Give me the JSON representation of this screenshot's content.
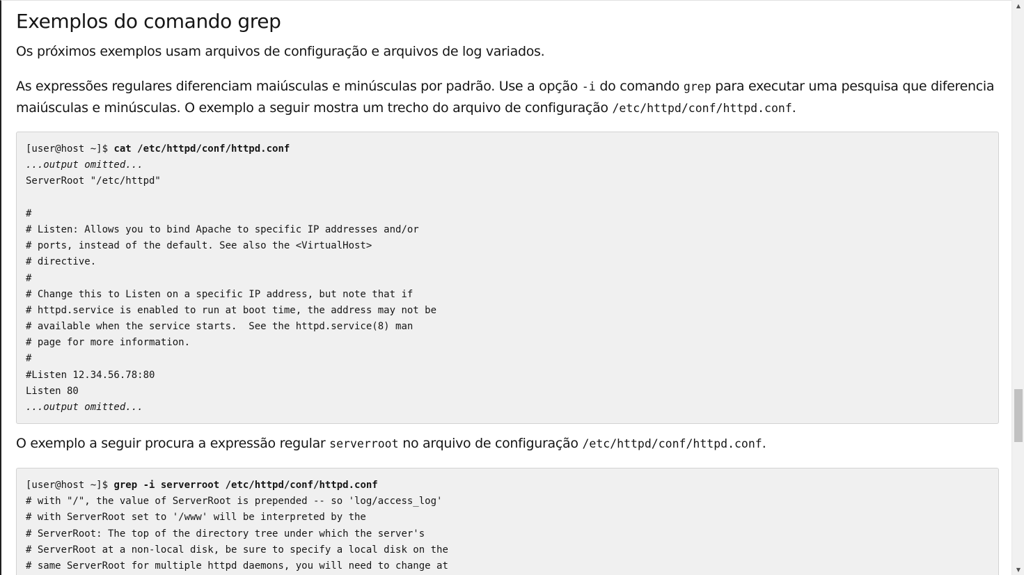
{
  "heading": "Exemplos do comando grep",
  "intro": "Os próximos exemplos usam arquivos de configuração e arquivos de log variados.",
  "para2": {
    "t1": "As expressões regulares diferenciam maiúsculas e minúsculas por padrão. Use a opção ",
    "c1": "-i",
    "t2": " do comando ",
    "c2": "grep",
    "t3": " para executar uma pesquisa que diferencia",
    "t4": "maiúsculas e minúsculas. O exemplo a seguir mostra um trecho do arquivo de configuração ",
    "c3": "/etc/httpd/conf/httpd.conf",
    "t5": "."
  },
  "code1": {
    "prompt": "[user@host ~]$ ",
    "command": "cat /etc/httpd/conf/httpd.conf",
    "lines": [
      "...output omitted...",
      "ServerRoot \"/etc/httpd\"",
      "",
      "#",
      "# Listen: Allows you to bind Apache to specific IP addresses and/or",
      "# ports, instead of the default. See also the <VirtualHost>",
      "# directive.",
      "#",
      "# Change this to Listen on a specific IP address, but note that if",
      "# httpd.service is enabled to run at boot time, the address may not be",
      "# available when the service starts.  See the httpd.service(8) man",
      "# page for more information.",
      "#",
      "#Listen 12.34.56.78:80",
      "Listen 80",
      "...output omitted..."
    ]
  },
  "para3": {
    "t1": "O exemplo a seguir procura a expressão regular ",
    "c1": "serverroot",
    "t2": " no arquivo de configuração ",
    "c2": "/etc/httpd/conf/httpd.conf",
    "t3": "."
  },
  "code2": {
    "prompt": "[user@host ~]$ ",
    "command": "grep -i serverroot /etc/httpd/conf/httpd.conf",
    "lines": [
      "# with \"/\", the value of ServerRoot is prepended -- so 'log/access_log'",
      "# with ServerRoot set to '/www' will be interpreted by the",
      "# ServerRoot: The top of the directory tree under which the server's",
      "# ServerRoot at a non-local disk, be sure to specify a local disk on the",
      "# same ServerRoot for multiple httpd daemons, you will need to change at"
    ]
  },
  "scrollbar": {
    "up_icon": "triangle-up",
    "down_icon": "triangle-down",
    "position_fraction": 0.7
  }
}
